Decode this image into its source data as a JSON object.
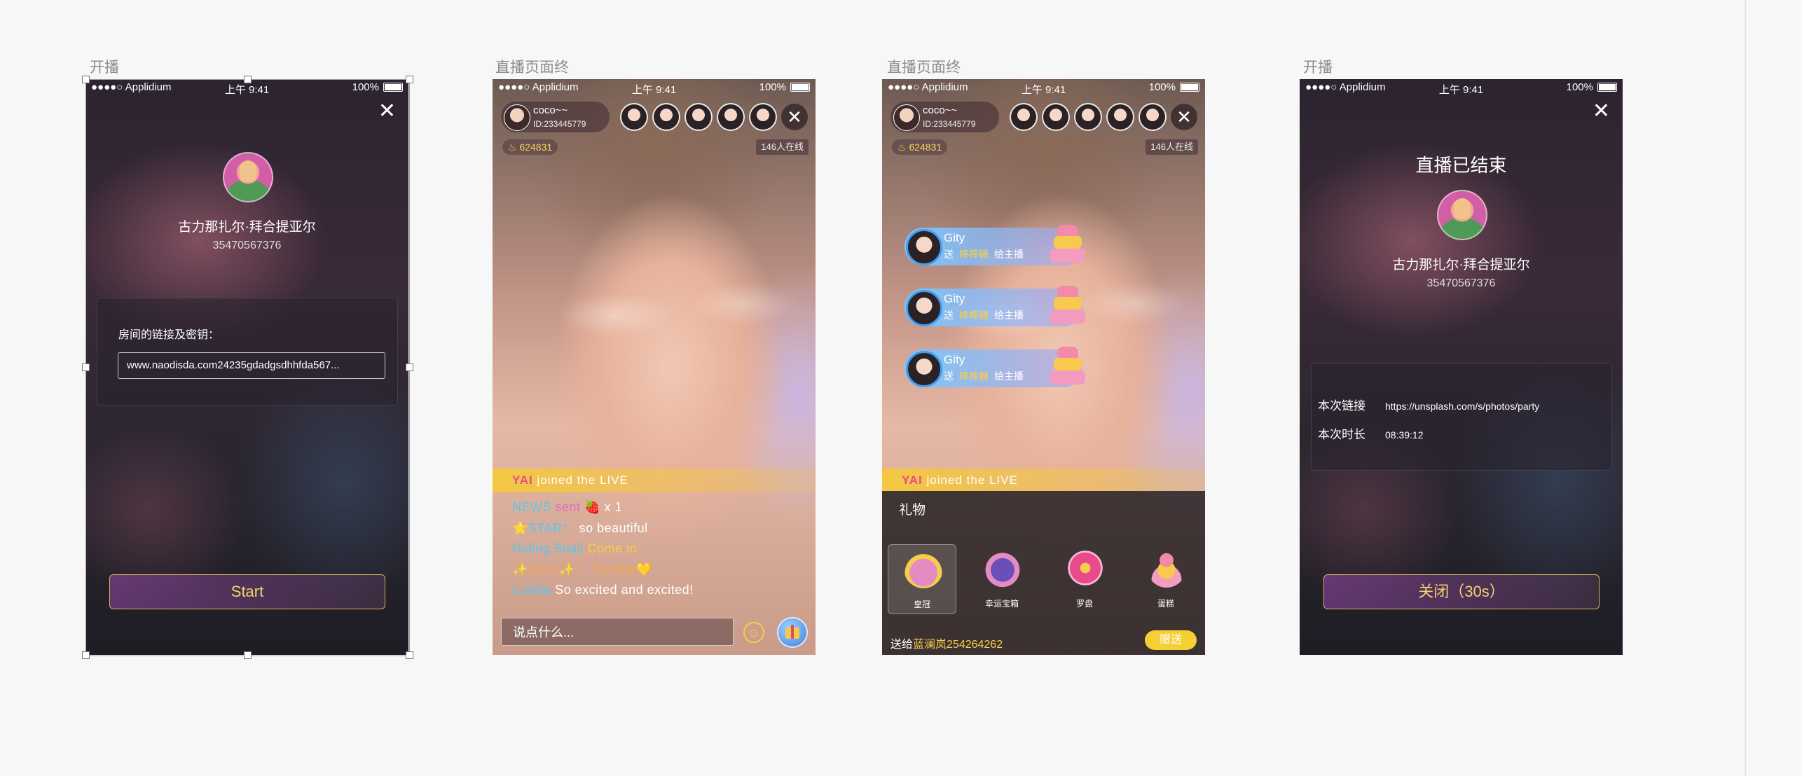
{
  "status_bar": {
    "carrier": "●●●●○ Applidium",
    "time": "上午 9:41",
    "battery": "100%"
  },
  "artboards": [
    {
      "title": "开播"
    },
    {
      "title": "直播页面终"
    },
    {
      "title": "直播页面终"
    },
    {
      "title": "开播"
    }
  ],
  "start_screen": {
    "name": "古力那扎尔·拜合提亚尔",
    "id": "35470567376",
    "link_label": "房间的链接及密钥：",
    "link_value": "www.naodisda.com24235gdadgsdhhfda567...",
    "start_label": "Start"
  },
  "live": {
    "host_name": "coco~~",
    "host_id": "ID:233445779",
    "heat": "624831",
    "online": "146人在线",
    "join_user": "YAI",
    "join_text": " joined the LIVE",
    "chat": [
      {
        "user": "NEWS",
        "verb": " sent ",
        "text": "x 1"
      },
      {
        "user": "⭐STAR：",
        "text": "so beautiful"
      },
      {
        "user": "Riding Snail",
        "text": "Come in"
      },
      {
        "user": "✨Coco✨：",
        "text": "Twinkle💛"
      },
      {
        "user": "Lulalla",
        "text": "So excited and excited!"
      }
    ],
    "say_placeholder": "说点什么...",
    "emoji_icon": "smile-icon",
    "gift_icon": "gift-icon"
  },
  "gifts_screen": {
    "popups": [
      {
        "name": "Gity",
        "send": "送",
        "gift": "棒棒糖",
        "to": "给主播"
      },
      {
        "name": "Gity",
        "send": "送",
        "gift": "棒棒糖",
        "to": "给主播"
      },
      {
        "name": "Gity",
        "send": "送",
        "gift": "棒棒糖",
        "to": "给主播"
      }
    ],
    "panel_title": "礼物",
    "items": [
      {
        "label": "皇冠"
      },
      {
        "label": "幸运宝箱"
      },
      {
        "label": "罗盘"
      },
      {
        "label": "蛋糕"
      }
    ],
    "send_to_prefix": "送给",
    "send_to_name": "蓝澜岚254264262",
    "send_label": "赠送"
  },
  "end_screen": {
    "title": "直播已结束",
    "name": "古力那扎尔·拜合提亚尔",
    "id": "35470567376",
    "link_key": "本次链接",
    "link_value": "https://unsplash.com/s/photos/party",
    "duration_key": "本次时长",
    "duration_value": "08:39:12",
    "close_label": "关闭（30s）"
  },
  "colors": {
    "gold": "#f4d36f",
    "chat_cyan": "#57c8ef",
    "chat_yellow": "#f6cf4a",
    "send_button": "#f6cf35"
  }
}
